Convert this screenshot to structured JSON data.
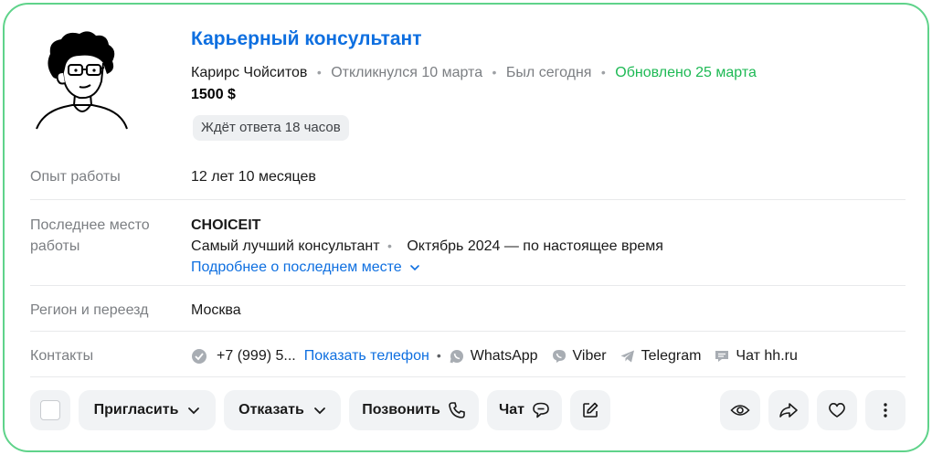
{
  "resume": {
    "title": "Карьерный консультант",
    "name": "Карирс Чойситов",
    "responded": "Откликнулся 10 марта",
    "last_seen": "Был сегодня",
    "updated": "Обновлено 25 марта",
    "salary": "1500 $",
    "waiting": "Ждёт ответа 18 часов"
  },
  "details": {
    "experience_label": "Опыт работы",
    "experience_value": "12 лет 10 месяцев",
    "last_job_label": "Последнее место работы",
    "company": "CHOICEIT",
    "position": "Самый лучший консультант",
    "period": "Октябрь 2024 — по настоящее время",
    "more_link": "Подробнее о последнем месте",
    "region_label": "Регион и переезд",
    "region_value": "Москва",
    "contacts_label": "Контакты",
    "phone": "+7 (999) 5...",
    "show_phone": "Показать телефон",
    "whatsapp": "WhatsApp",
    "viber": "Viber",
    "telegram": "Telegram",
    "hh_chat": "Чат hh.ru"
  },
  "actions": {
    "invite": "Пригласить",
    "reject": "Отказать",
    "call": "Позвонить",
    "chat": "Чат"
  },
  "icons": {
    "verified": "check-circle-icon",
    "whatsapp": "whatsapp-icon",
    "viber": "viber-icon",
    "telegram": "telegram-icon",
    "hh": "chat-bubble-icon",
    "edit": "pencil-icon",
    "view": "eye-icon",
    "share": "share-arrow-icon",
    "favorite": "heart-icon",
    "more": "kebab-menu-icon"
  },
  "colors": {
    "accent": "#0e6fe0",
    "updated": "#1db954",
    "border": "#5fd38a"
  }
}
